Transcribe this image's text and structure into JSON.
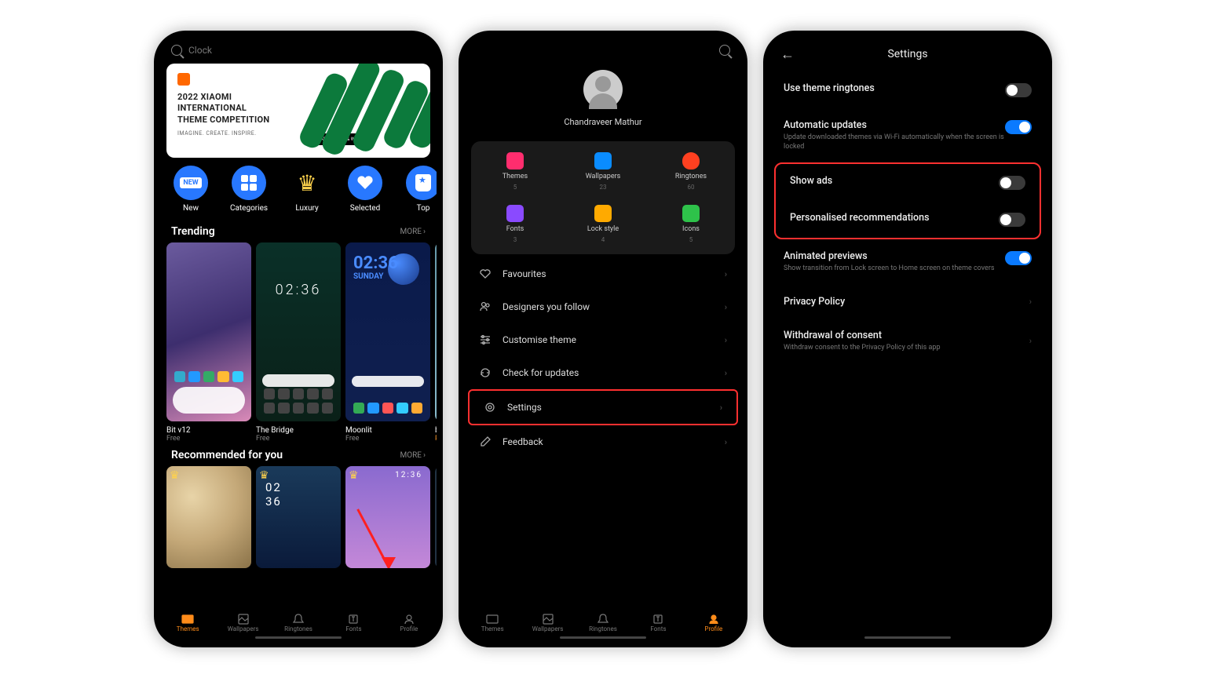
{
  "screen1": {
    "search_placeholder": "Clock",
    "banner": {
      "title_l1": "2022 XIAOMI",
      "title_l2": "INTERNATIONAL",
      "title_l3": "THEME COMPETITION",
      "tagline": "IMAGINE. CREATE. INSPIRE.",
      "button": "PARTICIPATE & WIN"
    },
    "categories": [
      {
        "label": "New"
      },
      {
        "label": "Categories"
      },
      {
        "label": "Luxury"
      },
      {
        "label": "Selected"
      },
      {
        "label": "Top"
      }
    ],
    "trending_title": "Trending",
    "trending_more": "MORE",
    "trending": [
      {
        "name": "Bit v12",
        "price": "Free"
      },
      {
        "name": "The Bridge",
        "price": "Free"
      },
      {
        "name": "Moonlit",
        "price": "Free"
      },
      {
        "name": "bubble",
        "price": "Premium"
      }
    ],
    "rec_title": "Recommended for you",
    "rec_more": "MORE",
    "rec_time1": "02\n36",
    "rec_time2": "12:36",
    "nav": [
      {
        "label": "Themes"
      },
      {
        "label": "Wallpapers"
      },
      {
        "label": "Ringtones"
      },
      {
        "label": "Fonts"
      },
      {
        "label": "Profile"
      }
    ],
    "t3_clock": "02:36",
    "t3_day": "SUNDAY",
    "t2_clock": "02:36"
  },
  "screen2": {
    "username": "Chandraveer Mathur",
    "grid": [
      {
        "label": "Themes",
        "count": "5"
      },
      {
        "label": "Wallpapers",
        "count": "23"
      },
      {
        "label": "Ringtones",
        "count": "60"
      },
      {
        "label": "Fonts",
        "count": "3"
      },
      {
        "label": "Lock style",
        "count": "4"
      },
      {
        "label": "Icons",
        "count": "5"
      }
    ],
    "menu": [
      {
        "label": "Favourites"
      },
      {
        "label": "Designers you follow"
      },
      {
        "label": "Customise theme"
      },
      {
        "label": "Check for updates"
      },
      {
        "label": "Settings"
      },
      {
        "label": "Feedback"
      }
    ],
    "nav": [
      {
        "label": "Themes"
      },
      {
        "label": "Wallpapers"
      },
      {
        "label": "Ringtones"
      },
      {
        "label": "Fonts"
      },
      {
        "label": "Profile"
      }
    ]
  },
  "screen3": {
    "title": "Settings",
    "rows": [
      {
        "title": "Use theme ringtones",
        "desc": "",
        "on": false,
        "type": "toggle"
      },
      {
        "title": "Automatic updates",
        "desc": "Update downloaded themes via Wi-Fi automatically when the screen is locked",
        "on": true,
        "type": "toggle"
      },
      {
        "title": "Show ads",
        "desc": "",
        "on": false,
        "type": "toggle",
        "hl": true
      },
      {
        "title": "Personalised recommendations",
        "desc": "",
        "on": false,
        "type": "toggle",
        "hl": true
      },
      {
        "title": "Animated previews",
        "desc": "Show transition from Lock screen to Home screen on theme covers",
        "on": true,
        "type": "toggle"
      },
      {
        "title": "Privacy Policy",
        "desc": "",
        "type": "link"
      },
      {
        "title": "Withdrawal of consent",
        "desc": "Withdraw consent to the Privacy Policy of this app",
        "type": "link"
      }
    ]
  }
}
